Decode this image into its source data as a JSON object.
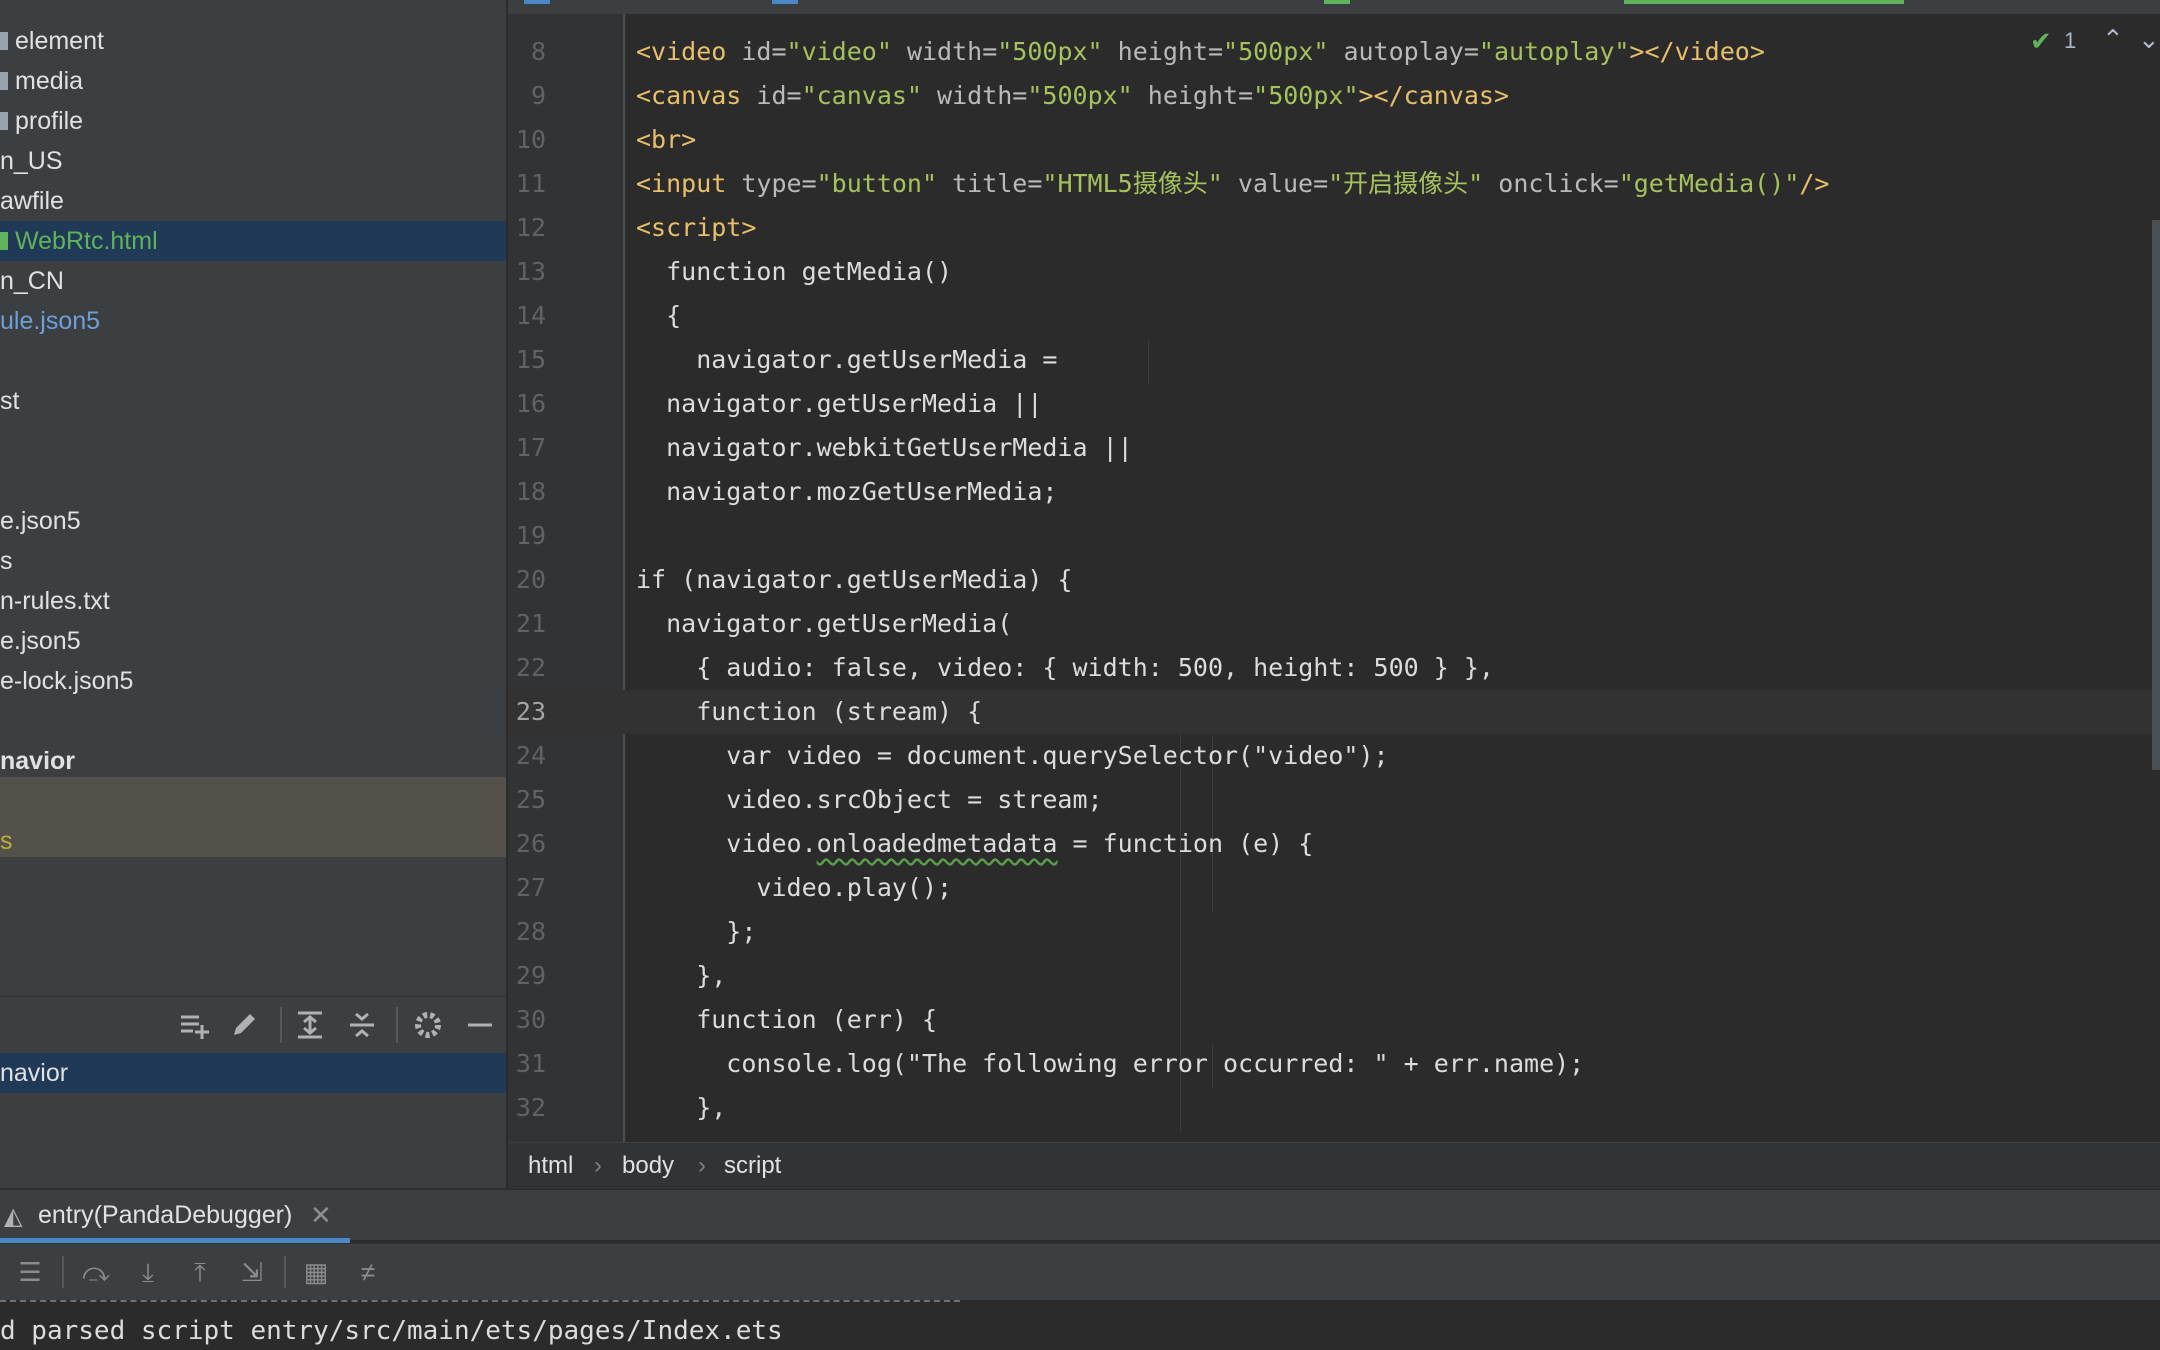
{
  "project_tree": {
    "items": [
      {
        "label": "element",
        "icon": "folder-icon"
      },
      {
        "label": "media",
        "icon": "folder-icon"
      },
      {
        "label": "profile",
        "icon": "folder-icon"
      },
      {
        "label": "n_US"
      },
      {
        "label": "awfile"
      },
      {
        "label": "WebRtc.html",
        "icon": "html-file-icon",
        "selected": true
      },
      {
        "label": "n_CN"
      },
      {
        "label": "ule.json5"
      },
      {
        "label": "st"
      },
      {
        "label": "e.json5"
      },
      {
        "label": "s"
      },
      {
        "label": "n-rules.txt"
      },
      {
        "label": "e.json5"
      },
      {
        "label": "e-lock.json5"
      },
      {
        "label": "navior"
      },
      {
        "label": "s"
      }
    ],
    "bottom_selected": "navior"
  },
  "editor": {
    "lines": [
      {
        "n": "8"
      },
      {
        "n": "9"
      },
      {
        "n": "10"
      },
      {
        "n": "11"
      },
      {
        "n": "12"
      },
      {
        "n": "13"
      },
      {
        "n": "14"
      },
      {
        "n": "15"
      },
      {
        "n": "16"
      },
      {
        "n": "17"
      },
      {
        "n": "18"
      },
      {
        "n": "19"
      },
      {
        "n": "20"
      },
      {
        "n": "21"
      },
      {
        "n": "22"
      },
      {
        "n": "23"
      },
      {
        "n": "24"
      },
      {
        "n": "25"
      },
      {
        "n": "26"
      },
      {
        "n": "27"
      },
      {
        "n": "28"
      },
      {
        "n": "29"
      },
      {
        "n": "30"
      },
      {
        "n": "31"
      },
      {
        "n": "32"
      }
    ],
    "code": {
      "l8": {
        "t1": "<video",
        "a1": " id=",
        "s1": "\"video\"",
        "a2": " width=",
        "s2": "\"500px\"",
        "a3": " height=",
        "s3": "\"500px\"",
        "a4": " autoplay=",
        "s4": "\"autoplay\"",
        "t2": "></video>"
      },
      "l9": {
        "t1": "<canvas",
        "a1": " id=",
        "s1": "\"canvas\"",
        "a2": " width=",
        "s2": "\"500px\"",
        "a3": " height=",
        "s3": "\"500px\"",
        "t2": "></canvas>"
      },
      "l10": {
        "t1": "<br>"
      },
      "l11": {
        "t1": "<input",
        "a1": " type=",
        "s1": "\"button\"",
        "a2": " title=",
        "s2": "\"HTML5摄像头\"",
        "a3": " value=",
        "s3": "\"开启摄像头\"",
        "a4": " onclick=",
        "s4": "\"getMedia()\"",
        "t2": "/>"
      },
      "l12": {
        "t1": "<script>"
      },
      "l13": "  function getMedia()",
      "l14": "  {",
      "l15": "    navigator.getUserMedia =",
      "l16": "  navigator.getUserMedia ||",
      "l17": "  navigator.webkitGetUserMedia ||",
      "l18": "  navigator.mozGetUserMedia;",
      "l19": "",
      "l20": "if (navigator.getUserMedia) {",
      "l21": "  navigator.getUserMedia(",
      "l22": "    { audio: false, video: { width: 500, height: 500 } },",
      "l23": "    function (stream) {",
      "l24": "      var video = document.querySelector(\"video\");",
      "l25": "      video.srcObject = stream;",
      "l26a": "      video.",
      "l26b": "onloadedmetadata",
      "l26c": " = function (e) {",
      "l27": "        video.play();",
      "l28": "      };",
      "l29": "    },",
      "l30": "    function (err) {",
      "l31": "      console.log(\"The following error occurred: \" + err.name);",
      "l32": "    },"
    },
    "inspection_count": "1",
    "current_line": "23"
  },
  "breadcrumb": [
    "html",
    "body",
    "script"
  ],
  "debug": {
    "tab_label": "entry(PandaDebugger)",
    "console_line": "d parsed script entry/src/main/ets/pages/Index.ets"
  },
  "colors": {
    "background": "#2b2b2b",
    "selection": "#1f3956",
    "tag": "#e8bf6a",
    "string": "#a5c25c",
    "accent": "#4a88c7"
  }
}
